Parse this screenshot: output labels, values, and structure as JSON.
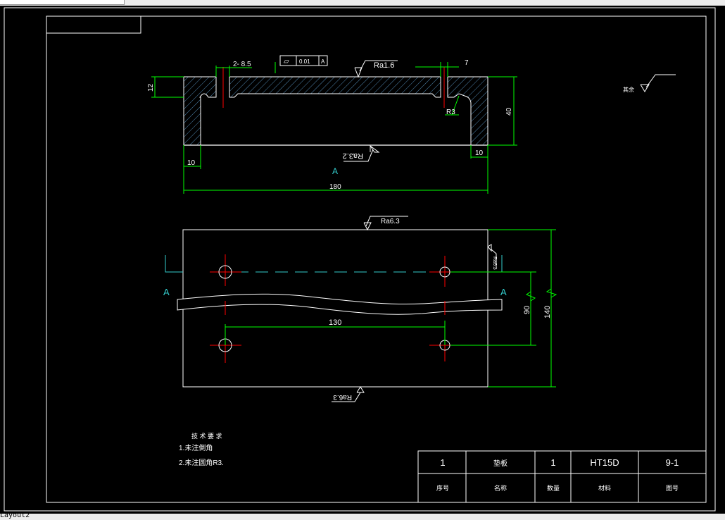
{
  "layout_tab": "Layout2",
  "colors": {
    "background": "#000000",
    "lines": "#ffffff",
    "dimensions": "#00ff00",
    "centerlines": "#ff0000",
    "section_marks": "#00ffff"
  },
  "section_view": {
    "dim_hole": "2- 8.5",
    "dim_top_right": "7",
    "flatness_symbol": "▱",
    "flatness_value": "0.01",
    "datum": "A",
    "roughness_top": "Ra1.6",
    "roughness_bottom": "Ra3.2",
    "dim_height_left": "12",
    "dim_height_right": "40",
    "radius": "R3",
    "dim_wall_left": "10",
    "dim_wall_right": "10",
    "dim_length": "180",
    "section_label": "A"
  },
  "plan_view": {
    "roughness_top": "Ra6.3",
    "roughness_bottom": "Ra6.3",
    "roughness_side": "Ra6.3",
    "section_left": "A",
    "section_right": "A",
    "dim_hole_spacing_x": "130",
    "dim_hole_spacing_y": "90",
    "dim_width": "140"
  },
  "other_roughness": {
    "label": "其余"
  },
  "tech_requirements": {
    "title": "技 术 要 求",
    "items": [
      "1.未注倒角",
      "2.未注圆角R3."
    ]
  },
  "title_block": {
    "row1": [
      "1",
      "垫板",
      "1",
      "HT15D",
      "9-1"
    ],
    "row2": [
      "序号",
      "名称",
      "数量",
      "材料",
      "图号"
    ]
  }
}
